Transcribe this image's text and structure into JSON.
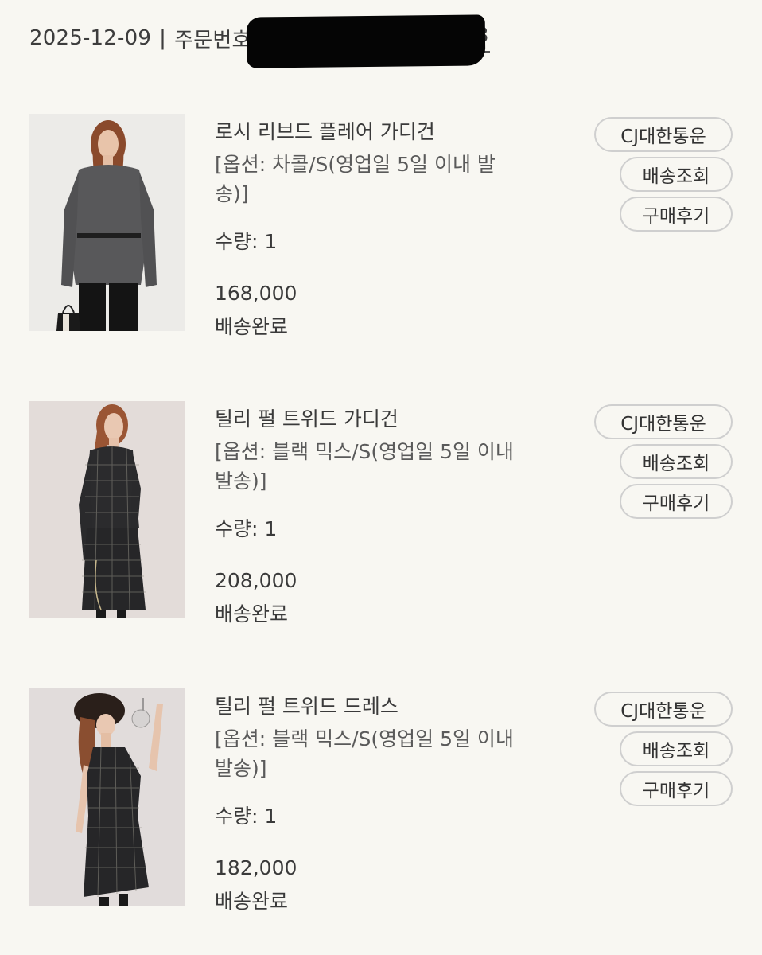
{
  "header": {
    "date": "2025-12-09",
    "separator": "|",
    "order_label": "주문번호",
    "order_tail": "3"
  },
  "items": [
    {
      "name": "로시 리브드 플레어 가디건",
      "option_line1": "[옵션: 차콜/S(영업일 5일 이내 발",
      "option_line2": "송)]",
      "quantity": "수량: 1",
      "price": "168,000",
      "status": "배송완료",
      "carrier_button": "CJ대한통운",
      "track_button": "배송조회",
      "review_button": "구매후기"
    },
    {
      "name": "틸리 펄 트위드 가디건",
      "option_line1": "[옵션: 블랙 믹스/S(영업일 5일 이내",
      "option_line2": "발송)]",
      "quantity": "수량: 1",
      "price": "208,000",
      "status": "배송완료",
      "carrier_button": "CJ대한통운",
      "track_button": "배송조회",
      "review_button": "구매후기"
    },
    {
      "name": "틸리 펄 트위드 드레스",
      "option_line1": "[옵션: 블랙 믹스/S(영업일 5일 이내",
      "option_line2": "발송)]",
      "quantity": "수량: 1",
      "price": "182,000",
      "status": "배송완료",
      "carrier_button": "CJ대한통운",
      "track_button": "배송조회",
      "review_button": "구매후기"
    }
  ],
  "colors": {
    "background": "#f8f7f2",
    "text": "#3a3a3a",
    "button_border": "#cfcfcf"
  }
}
